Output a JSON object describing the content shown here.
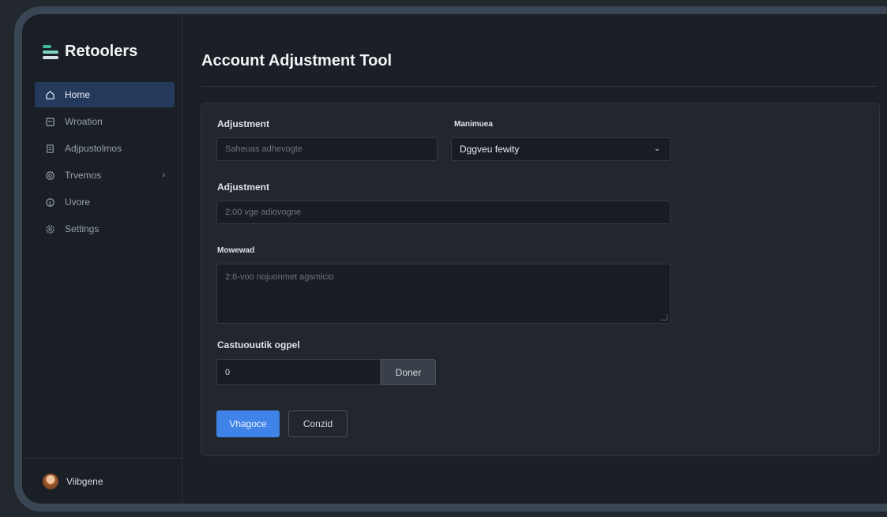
{
  "app": {
    "name": "Retoolers"
  },
  "sidebar": {
    "items": [
      {
        "label": "Home",
        "icon": "home-icon",
        "active": true
      },
      {
        "label": "Wroation",
        "icon": "document-icon"
      },
      {
        "label": "Adjpustolmos",
        "icon": "adjustments-icon"
      },
      {
        "label": "Trvemos",
        "icon": "settings-circle-icon",
        "has_chevron": true
      },
      {
        "label": "Uvore",
        "icon": "dollar-icon"
      },
      {
        "label": "Settings",
        "icon": "gear-icon"
      }
    ],
    "user": {
      "name": "Viibgene"
    }
  },
  "page": {
    "title": "Account Adjustment Tool"
  },
  "form": {
    "adjustment_label": "Adjustment",
    "adjustment_placeholder": "Saheuas adhevogte",
    "manimuea_label": "Manimuea",
    "manimuea_value": "Dggveu fewity",
    "adjustment2_label": "Adjustment",
    "adjustment2_placeholder": "2:00 vge adiovogne",
    "mowewad_label": "Mowewad",
    "mowewad_placeholder": "2:6-voo nojuonmet agsmicio",
    "amount_label": "Castuouutik ogpel",
    "amount_value": "0",
    "amount_addon": "Doner",
    "submit_label": "Vhagoce",
    "cancel_label": "Conzid"
  },
  "colors": {
    "accent": "#3f83e8",
    "active_nav": "#233a5c",
    "background": "#1b1f26"
  }
}
